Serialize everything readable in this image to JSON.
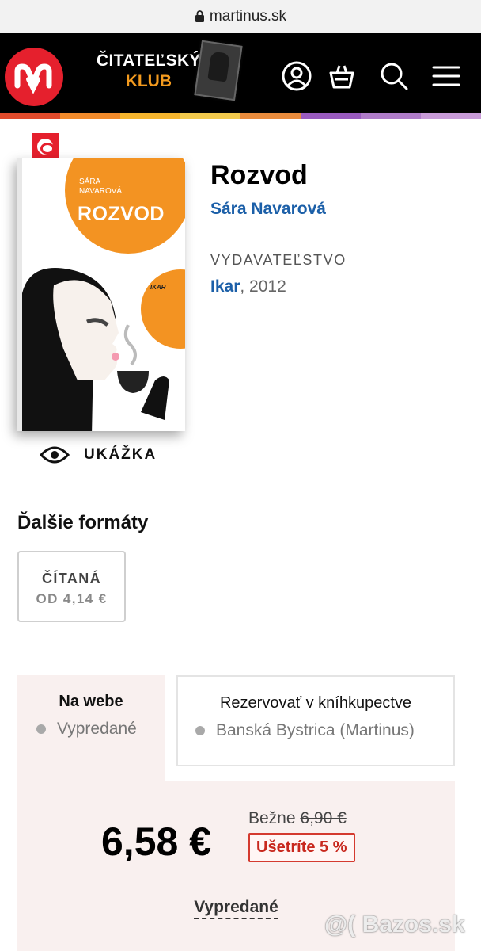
{
  "browser": {
    "url": "martinus.sk"
  },
  "header": {
    "club_line1": "ČITATEĽSKÝ",
    "club_line2": "KLUB",
    "icons": [
      "logo-icon",
      "account-icon",
      "basket-icon",
      "search-icon",
      "menu-icon"
    ],
    "brand_color": "#e5202d",
    "club_color": "#f39a1e"
  },
  "stripe_colors": [
    "#e14b2c",
    "#f08a2b",
    "#f5b52e",
    "#f2c94c",
    "#e98b3c",
    "#9a5bbf",
    "#b07cc9",
    "#c99bd8"
  ],
  "book": {
    "cover_author": "SÁRA\nNAVAROVÁ",
    "cover_title": "ROZVOD",
    "cover_publisher": "IKAR",
    "preview_label": "UKÁŽKA",
    "title": "Rozvod",
    "author": "Sára Navarová",
    "publisher_label": "VYDAVATEĽSTVO",
    "publisher": "Ikar",
    "year": ", 2012"
  },
  "formats": {
    "title": "Ďalšie formáty",
    "items": [
      {
        "line1": "ČÍTANÁ",
        "line2": "OD 4,14 €"
      }
    ]
  },
  "availability": {
    "web_tab": {
      "title": "Na webe",
      "status": "Vypredané"
    },
    "store_tab": {
      "title": "Rezervovať v kníhkupectve",
      "status": "Banská Bystrica (Martinus)"
    }
  },
  "pricing": {
    "price": "6,58 €",
    "regular_label": "Bežne ",
    "regular_price": "6,90 €",
    "save": "Ušetríte 5 %",
    "soldout": "Vypredané"
  },
  "watermark": "@( Bazos.sk"
}
